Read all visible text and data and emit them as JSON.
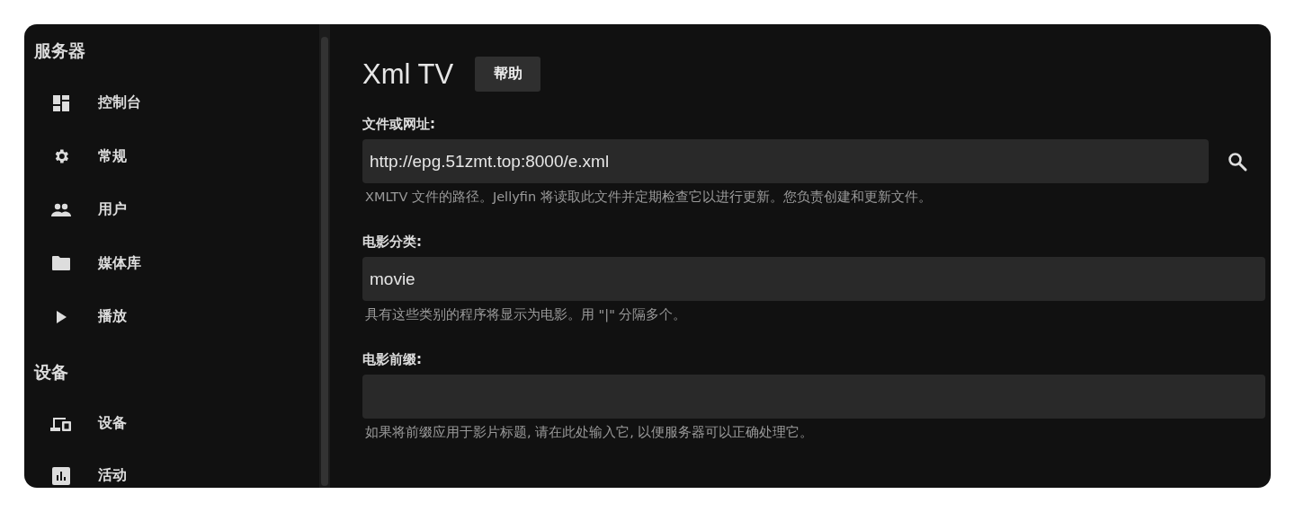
{
  "sidebar": {
    "sections": [
      {
        "heading": "服务器",
        "items": [
          {
            "label": "控制台"
          },
          {
            "label": "常规"
          },
          {
            "label": "用户"
          },
          {
            "label": "媒体库"
          },
          {
            "label": "播放"
          }
        ]
      },
      {
        "heading": "设备",
        "items": [
          {
            "label": "设备"
          },
          {
            "label": "活动"
          }
        ]
      }
    ]
  },
  "page": {
    "title": "Xml TV",
    "help_button": "帮助",
    "fields": [
      {
        "label": "文件或网址:",
        "value": "http://epg.51zmt.top:8000/e.xml",
        "search_button": true,
        "description": "XMLTV 文件的路径。Jellyfin 将读取此文件并定期检查它以进行更新。您负责创建和更新文件。"
      },
      {
        "label": "电影分类:",
        "value": "movie",
        "search_button": false,
        "description": "具有这些类别的程序将显示为电影。用 \"|\" 分隔多个。"
      },
      {
        "label": "电影前缀:",
        "search_button": false,
        "description": "如果将前缀应用于影片标题, 请在此处输入它, 以便服务器可以正确处理它。"
      }
    ]
  }
}
